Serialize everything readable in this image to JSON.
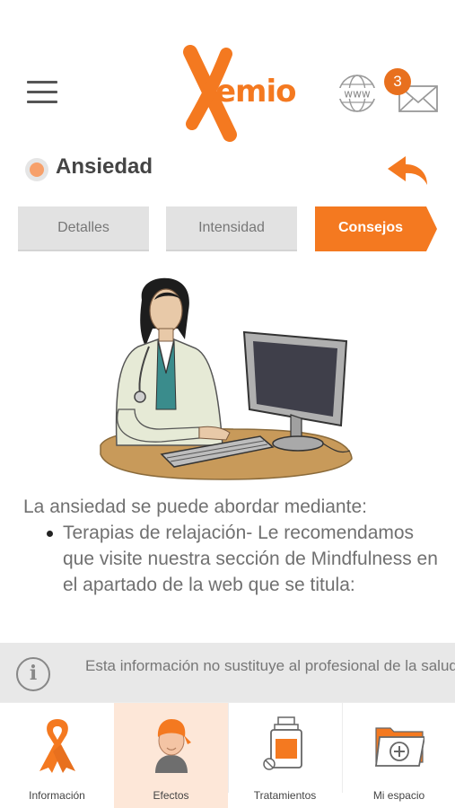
{
  "header": {
    "logo_text": "emio",
    "notification_count": "3",
    "icons": {
      "menu": "hamburger-menu-icon",
      "web": "globe-www-icon",
      "mail": "mail-icon"
    }
  },
  "page": {
    "title": "Ansiedad"
  },
  "tabs": [
    {
      "label": "Detalles",
      "active": false
    },
    {
      "label": "Intensidad",
      "active": false
    },
    {
      "label": "Consejos",
      "active": true
    }
  ],
  "content": {
    "intro": "La ansiedad se puede abordar mediante:",
    "bullets": [
      "Terapias de relajación- Le recomendamos que visite nuestra sección de Mindfulness en el apartado de la web que se titula:"
    ]
  },
  "info_bar": {
    "text": "Esta información no sustituye al profesional de la salud"
  },
  "bottom_nav": [
    {
      "label": "Información",
      "icon": "ribbon-icon",
      "active": false
    },
    {
      "label": "Efectos",
      "icon": "patient-bandana-icon",
      "active": true
    },
    {
      "label": "Tratamientos",
      "icon": "medicine-bottle-icon",
      "active": false
    },
    {
      "label": "Mi espacio",
      "icon": "folder-add-icon",
      "active": false
    }
  ],
  "colors": {
    "accent": "#f47920",
    "active_nav_bg": "#fde7d8",
    "info_bar_bg": "#e8e8e8"
  }
}
